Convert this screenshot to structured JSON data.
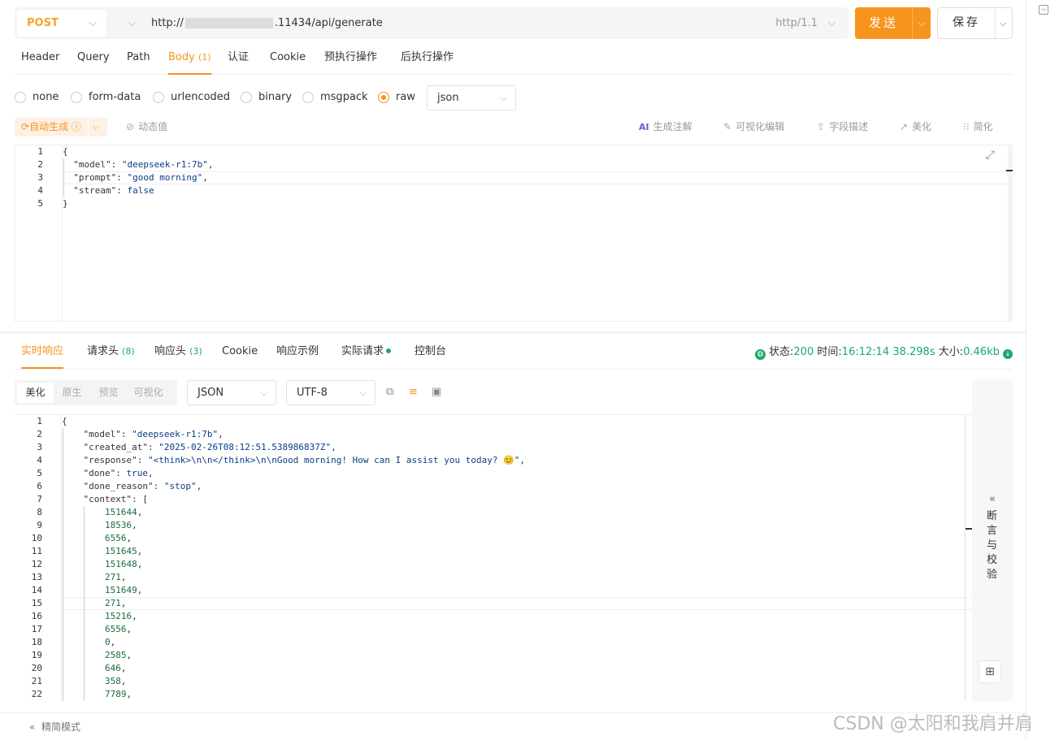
{
  "request": {
    "method": "POST",
    "url_prefix": "http://",
    "url_suffix": ".11434/api/generate",
    "protocol": "http/1.1",
    "send_label": "发送",
    "save_label": "保存"
  },
  "request_tabs": [
    {
      "label": "Header"
    },
    {
      "label": "Query"
    },
    {
      "label": "Path"
    },
    {
      "label": "Body",
      "count": "(1)",
      "active": true
    },
    {
      "label": "认证"
    },
    {
      "label": "Cookie"
    },
    {
      "label": "预执行操作"
    },
    {
      "label": "后执行操作"
    }
  ],
  "body_types": [
    "none",
    "form-data",
    "urlencoded",
    "binary",
    "msgpack",
    "raw"
  ],
  "body_type_selected": "raw",
  "body_format": "json",
  "toolbar": {
    "auto_generate": "自动生成",
    "dynamic_value": "动态值",
    "generate_comment": "生成注解",
    "visual_edit": "可视化编辑",
    "field_desc": "字段描述",
    "beautify": "美化",
    "simplify": "简化"
  },
  "request_body_lines": [
    "{",
    "  \"model\": \"deepseek-r1:7b\",",
    "  \"prompt\": \"good morning\",",
    "  \"stream\": false",
    "}"
  ],
  "response_tabs": [
    {
      "label": "实时响应",
      "active": true
    },
    {
      "label": "请求头",
      "count": "(8)"
    },
    {
      "label": "响应头",
      "count": "(3)"
    },
    {
      "label": "Cookie"
    },
    {
      "label": "响应示例"
    },
    {
      "label": "实际请求"
    },
    {
      "label": "控制台"
    }
  ],
  "status": {
    "status_label": "状态:",
    "status_code": "200",
    "time_label": "时间:",
    "time": "16:12:14",
    "duration": "38.298s",
    "size_label": "大小:",
    "size": "0.46kb"
  },
  "view_modes": [
    "美化",
    "原生",
    "预览",
    "可视化"
  ],
  "response_format": "JSON",
  "response_encoding": "UTF-8",
  "response_lines": [
    "{",
    "    \"model\": \"deepseek-r1:7b\",",
    "    \"created_at\": \"2025-02-26T08:12:51.538986837Z\",",
    "    \"response\": \"<think>\\n\\n</think>\\n\\nGood morning! How can I assist you today? 😊\",",
    "    \"done\": true,",
    "    \"done_reason\": \"stop\",",
    "    \"context\": [",
    "        151644,",
    "        18536,",
    "        6556,",
    "        151645,",
    "        151648,",
    "        271,",
    "        151649,",
    "        271,",
    "        15216,",
    "        6556,",
    "        0,",
    "        2585,",
    "        646,",
    "        358,",
    "        7789,"
  ],
  "assert_panel": {
    "chevron": "«",
    "text": "断言与校验"
  },
  "footer": {
    "simple_mode": "精简模式"
  },
  "watermark": "CSDN @太阳和我肩并肩"
}
